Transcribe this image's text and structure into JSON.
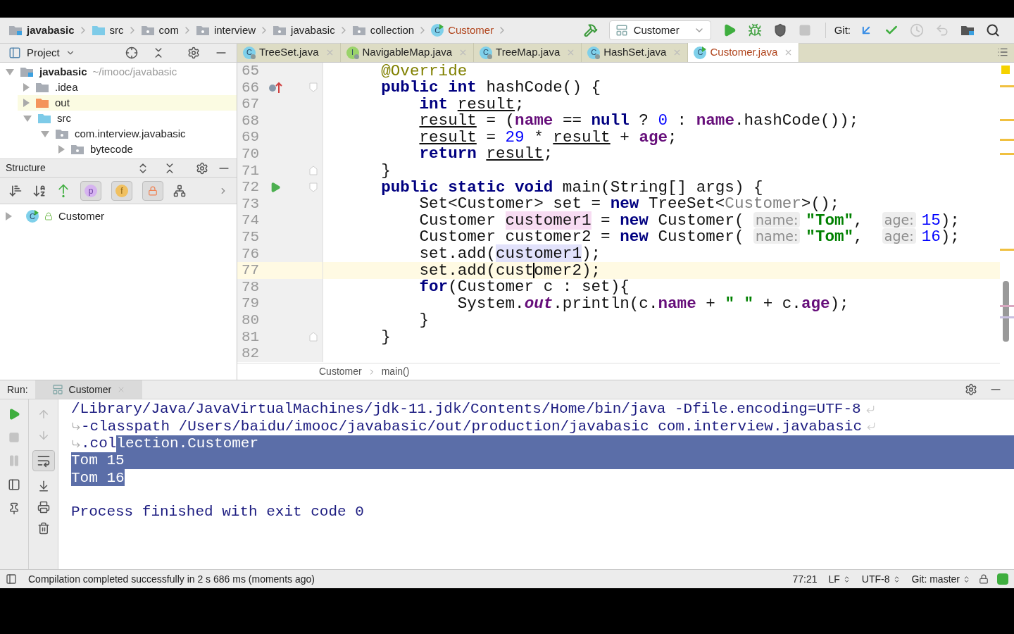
{
  "breadcrumbs": [
    {
      "label": "javabasic",
      "kind": "module"
    },
    {
      "label": "src",
      "kind": "source"
    },
    {
      "label": "com",
      "kind": "package"
    },
    {
      "label": "interview",
      "kind": "package"
    },
    {
      "label": "javabasic",
      "kind": "package"
    },
    {
      "label": "collection",
      "kind": "package"
    },
    {
      "label": "Customer",
      "kind": "class",
      "badge": "C"
    }
  ],
  "toolbar": [
    {
      "kind": "build",
      "disabled": false
    },
    {
      "kind": "config",
      "label": "Customer",
      "disabled": false
    },
    {
      "kind": "run",
      "disabled": false
    },
    {
      "kind": "debug",
      "disabled": false
    },
    {
      "kind": "coverage",
      "disabled": false
    },
    {
      "kind": "stop",
      "disabled": true
    },
    {
      "kind": "git",
      "label": "Git:"
    },
    {
      "kind": "update",
      "disabled": false
    },
    {
      "kind": "commit",
      "disabled": false
    },
    {
      "kind": "history",
      "disabled": true
    },
    {
      "kind": "revert",
      "disabled": true
    },
    {
      "kind": "structure",
      "disabled": false
    },
    {
      "kind": "search",
      "disabled": false
    }
  ],
  "project": {
    "title": "Project",
    "tree": [
      {
        "label": "javabasic",
        "path": "~/imooc/javabasic",
        "kind": "module",
        "expanded": true,
        "excluded": false,
        "children": [
          {
            "label": ".idea",
            "kind": "folder",
            "color": "#a8adb5",
            "expanded": false,
            "excluded": false
          },
          {
            "label": "out",
            "kind": "folder",
            "color": "#f4945c",
            "expanded": false,
            "excluded": true
          },
          {
            "label": "src",
            "kind": "folder",
            "color": "#7ecbe8",
            "expanded": true,
            "excluded": false,
            "children": [
              {
                "label": "com.interview.javabasic",
                "kind": "package",
                "color": "#a8adb5",
                "expanded": true,
                "excluded": false,
                "children": [
                  {
                    "label": "bytecode",
                    "kind": "package",
                    "color": "#a8adb5",
                    "expanded": false,
                    "excluded": false
                  }
                ]
              }
            ]
          }
        ]
      }
    ]
  },
  "structure": {
    "title": "Structure",
    "toggles": [
      {
        "kind": "sort_visibility",
        "on": false
      },
      {
        "kind": "sort_alpha",
        "on": false
      },
      {
        "kind": "inherited",
        "on": false
      },
      {
        "kind": "properties",
        "badge": "p",
        "on": true
      },
      {
        "kind": "fields",
        "badge": "f",
        "on": true
      },
      {
        "kind": "non_public",
        "on": true
      },
      {
        "kind": "lambdas",
        "on": false
      }
    ],
    "items": [
      {
        "label": "Customer",
        "badge": "C",
        "expanded": false
      }
    ]
  },
  "editor_tabs": [
    {
      "label": "TreeSet.java",
      "badge": "C",
      "kind": "class",
      "locked": true,
      "selected": false
    },
    {
      "label": "NavigableMap.java",
      "badge": "I",
      "kind": "interface",
      "locked": true,
      "selected": false
    },
    {
      "label": "TreeMap.java",
      "badge": "C",
      "kind": "class",
      "locked": true,
      "selected": false
    },
    {
      "label": "HashSet.java",
      "badge": "C",
      "kind": "class",
      "locked": true,
      "selected": false
    },
    {
      "label": "Customer.java",
      "badge": "C",
      "kind": "class",
      "locked": false,
      "selected": true
    }
  ],
  "editor": {
    "lines": [
      {
        "number": "65",
        "current": false,
        "overrides": false,
        "runnable": false,
        "fold_start": false,
        "fold_end": false,
        "tokens": [
          {
            "kind": "annotation",
            "text": "    @Override"
          }
        ]
      },
      {
        "number": "66",
        "current": false,
        "overrides": true,
        "runnable": false,
        "fold_start": true,
        "fold_end": false,
        "tokens": [
          {
            "kind": "keyword",
            "text": "    public int"
          },
          {
            "kind": "plain",
            "text": " hashCode() {"
          }
        ]
      },
      {
        "number": "67",
        "current": false,
        "overrides": false,
        "runnable": false,
        "fold_start": false,
        "fold_end": false,
        "tokens": [
          {
            "kind": "keyword",
            "text": "        int "
          },
          {
            "kind": "local",
            "text": "result"
          },
          {
            "kind": "plain",
            "text": ";"
          }
        ]
      },
      {
        "number": "68",
        "current": false,
        "overrides": false,
        "runnable": false,
        "fold_start": false,
        "fold_end": false,
        "tokens": [
          {
            "kind": "local",
            "text": "        result"
          },
          {
            "kind": "plain",
            "text": " = ("
          },
          {
            "kind": "field",
            "text": "name"
          },
          {
            "kind": "plain",
            "text": " == "
          },
          {
            "kind": "keyword",
            "text": "null"
          },
          {
            "kind": "plain",
            "text": " ? "
          },
          {
            "kind": "number",
            "text": "0"
          },
          {
            "kind": "plain",
            "text": " : "
          },
          {
            "kind": "field",
            "text": "name"
          },
          {
            "kind": "plain",
            "text": ".hashCode());"
          }
        ]
      },
      {
        "number": "69",
        "current": false,
        "overrides": false,
        "runnable": false,
        "fold_start": false,
        "fold_end": false,
        "tokens": [
          {
            "kind": "local",
            "text": "        result"
          },
          {
            "kind": "plain",
            "text": " = "
          },
          {
            "kind": "number",
            "text": "29"
          },
          {
            "kind": "plain",
            "text": " * "
          },
          {
            "kind": "local",
            "text": "result"
          },
          {
            "kind": "plain",
            "text": " + "
          },
          {
            "kind": "field",
            "text": "age"
          },
          {
            "kind": "plain",
            "text": ";"
          }
        ]
      },
      {
        "number": "70",
        "current": false,
        "overrides": false,
        "runnable": false,
        "fold_start": false,
        "fold_end": false,
        "tokens": [
          {
            "kind": "keyword",
            "text": "        return "
          },
          {
            "kind": "local",
            "text": "result"
          },
          {
            "kind": "plain",
            "text": ";"
          }
        ]
      },
      {
        "number": "71",
        "current": false,
        "overrides": false,
        "runnable": false,
        "fold_start": false,
        "fold_end": true,
        "tokens": [
          {
            "kind": "plain",
            "text": "    }"
          }
        ]
      },
      {
        "number": "72",
        "current": false,
        "overrides": false,
        "runnable": true,
        "fold_start": true,
        "fold_end": false,
        "tokens": [
          {
            "kind": "keyword",
            "text": "    public static void"
          },
          {
            "kind": "plain",
            "text": " main(String[] args) {"
          }
        ]
      },
      {
        "number": "73",
        "current": false,
        "overrides": false,
        "runnable": false,
        "fold_start": false,
        "fold_end": false,
        "tokens": [
          {
            "kind": "plain",
            "text": "        Set<Customer> set = "
          },
          {
            "kind": "keyword",
            "text": "new"
          },
          {
            "kind": "plain",
            "text": " TreeSet<"
          },
          {
            "kind": "type_argument",
            "text": "Customer"
          },
          {
            "kind": "plain",
            "text": ">();"
          }
        ]
      },
      {
        "number": "74",
        "current": false,
        "overrides": false,
        "runnable": false,
        "fold_start": false,
        "fold_end": false,
        "tokens": [
          {
            "kind": "plain",
            "text": "        Customer "
          },
          {
            "kind": "declaration",
            "text": "customer1"
          },
          {
            "kind": "plain",
            "text": " = "
          },
          {
            "kind": "keyword",
            "text": "new"
          },
          {
            "kind": "plain",
            "text": " Customer( "
          },
          {
            "kind": "hint",
            "text": "name:"
          },
          {
            "kind": "string",
            "text": "\"Tom\""
          },
          {
            "kind": "plain",
            "text": ",  "
          },
          {
            "kind": "hint",
            "text": "age:"
          },
          {
            "kind": "number",
            "text": "15"
          },
          {
            "kind": "plain",
            "text": ");"
          }
        ]
      },
      {
        "number": "75",
        "current": false,
        "overrides": false,
        "runnable": false,
        "fold_start": false,
        "fold_end": false,
        "tokens": [
          {
            "kind": "plain",
            "text": "        Customer customer2 = "
          },
          {
            "kind": "keyword",
            "text": "new"
          },
          {
            "kind": "plain",
            "text": " Customer( "
          },
          {
            "kind": "hint",
            "text": "name:"
          },
          {
            "kind": "string",
            "text": "\"Tom\""
          },
          {
            "kind": "plain",
            "text": ",  "
          },
          {
            "kind": "hint",
            "text": "age:"
          },
          {
            "kind": "number",
            "text": "16"
          },
          {
            "kind": "plain",
            "text": ");"
          }
        ]
      },
      {
        "number": "76",
        "current": false,
        "overrides": false,
        "runnable": false,
        "fold_start": false,
        "fold_end": false,
        "tokens": [
          {
            "kind": "plain",
            "text": "        set.add("
          },
          {
            "kind": "usage",
            "text": "customer1"
          },
          {
            "kind": "plain",
            "text": ");"
          }
        ]
      },
      {
        "number": "77",
        "current": true,
        "overrides": false,
        "runnable": false,
        "fold_start": false,
        "fold_end": false,
        "tokens": [
          {
            "kind": "plain",
            "text": "        set.add(cust"
          },
          {
            "kind": "caret"
          },
          {
            "kind": "plain",
            "text": "omer2);"
          }
        ]
      },
      {
        "number": "78",
        "current": false,
        "overrides": false,
        "runnable": false,
        "fold_start": false,
        "fold_end": false,
        "tokens": [
          {
            "kind": "keyword",
            "text": "        for"
          },
          {
            "kind": "plain",
            "text": "(Customer c : set){"
          }
        ]
      },
      {
        "number": "79",
        "current": false,
        "overrides": false,
        "runnable": false,
        "fold_start": false,
        "fold_end": false,
        "tokens": [
          {
            "kind": "plain",
            "text": "            System."
          },
          {
            "kind": "static_field",
            "text": "out"
          },
          {
            "kind": "plain",
            "text": ".println(c."
          },
          {
            "kind": "field",
            "text": "name"
          },
          {
            "kind": "plain",
            "text": " + "
          },
          {
            "kind": "string",
            "text": "\" \""
          },
          {
            "kind": "plain",
            "text": " + c."
          },
          {
            "kind": "field",
            "text": "age"
          },
          {
            "kind": "plain",
            "text": ");"
          }
        ]
      },
      {
        "number": "80",
        "current": false,
        "overrides": false,
        "runnable": false,
        "fold_start": false,
        "fold_end": false,
        "tokens": [
          {
            "kind": "plain",
            "text": "        }"
          }
        ]
      },
      {
        "number": "81",
        "current": false,
        "overrides": false,
        "runnable": false,
        "fold_start": false,
        "fold_end": true,
        "tokens": [
          {
            "kind": "plain",
            "text": "    }"
          }
        ]
      },
      {
        "number": "82",
        "current": false,
        "overrides": false,
        "runnable": false,
        "fold_start": false,
        "fold_end": false
      }
    ],
    "breadcrumb": [
      "Customer",
      "main()"
    ]
  },
  "run": {
    "label": "Run:",
    "tab": "Customer",
    "left_toolbar": [
      {
        "kind": "rerun",
        "disabled": false
      },
      {
        "kind": "stop",
        "disabled": true
      },
      {
        "kind": "pause",
        "disabled": true
      },
      {
        "kind": "layout",
        "disabled": false
      },
      {
        "kind": "pin",
        "disabled": false
      }
    ],
    "right_toolbar": [
      {
        "kind": "up",
        "disabled": true
      },
      {
        "kind": "down",
        "disabled": true
      },
      {
        "kind": "wrap",
        "on": true
      },
      {
        "kind": "scroll_end",
        "on": false
      },
      {
        "kind": "print",
        "on": false
      },
      {
        "kind": "trash",
        "on": false
      }
    ],
    "console": [
      {
        "wrap_start": false,
        "wrap_end": true,
        "selected_to_end": false,
        "segments": [
          {
            "text": "/Library/Java/JavaVirtualMachines/jdk-11.jdk/Contents/Home/bin/java -Dfile.encoding=UTF-8",
            "selected": false
          }
        ]
      },
      {
        "wrap_start": true,
        "wrap_end": true,
        "selected_to_end": false,
        "segments": [
          {
            "text": "-classpath /Users/baidu/imooc/javabasic/out/production/javabasic com.interview.javabasic",
            "selected": false
          }
        ]
      },
      {
        "wrap_start": true,
        "wrap_end": false,
        "selected_to_end": true,
        "segments": [
          {
            "text": ".col",
            "selected": false
          },
          {
            "text": "lection.Customer",
            "selected": true
          }
        ]
      },
      {
        "wrap_start": false,
        "wrap_end": false,
        "selected_to_end": true,
        "segments": [
          {
            "text": "Tom 15",
            "selected": true
          }
        ]
      },
      {
        "wrap_start": false,
        "wrap_end": false,
        "selected_to_end": false,
        "segments": [
          {
            "text": "Tom 16",
            "selected": true
          }
        ]
      },
      {
        "wrap_start": false,
        "wrap_end": false,
        "selected_to_end": false
      },
      {
        "wrap_start": false,
        "wrap_end": false,
        "selected_to_end": false,
        "segments": [
          {
            "text": "Process finished with exit code 0",
            "selected": false
          }
        ]
      }
    ]
  },
  "status_bar": {
    "message": "Compilation completed successfully in 2 s 686 ms (moments ago)",
    "position": "77:21",
    "line_separator": "LF",
    "encoding": "UTF-8",
    "branch": "Git: master"
  }
}
